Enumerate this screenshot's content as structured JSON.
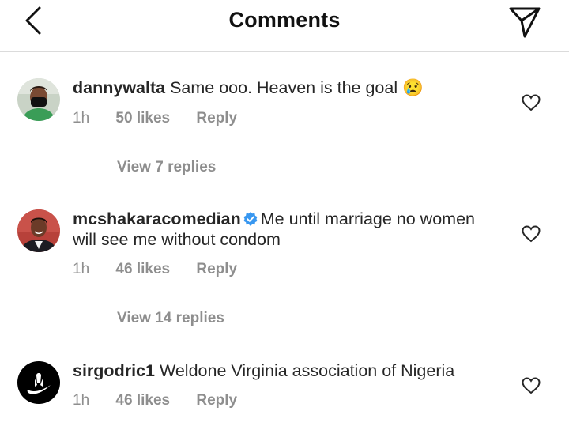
{
  "header": {
    "title": "Comments",
    "back_icon": "chevron-left-icon",
    "send_icon": "paper-plane-icon"
  },
  "comments": [
    {
      "username": "dannywalta",
      "text": "Same ooo. Heaven is the goal",
      "emoji": "😢",
      "time": "1h",
      "likes": "50 likes",
      "reply": "Reply",
      "view_replies": "View 7 replies",
      "verified": false
    },
    {
      "username": "mcshakaracomedian",
      "text": "Me until marriage no women will see me without condom",
      "time": "1h",
      "likes": "46 likes",
      "reply": "Reply",
      "view_replies": "View 14 replies",
      "verified": true
    },
    {
      "username": "sirgodric1",
      "text": "Weldone Virginia association of Nigeria",
      "time": "1h",
      "likes": "46 likes",
      "reply": "Reply",
      "verified": false
    }
  ],
  "colors": {
    "text": "#262626",
    "secondary": "#8e8e8e",
    "verified_blue": "#3897f0",
    "divider": "#dbdbdb"
  }
}
